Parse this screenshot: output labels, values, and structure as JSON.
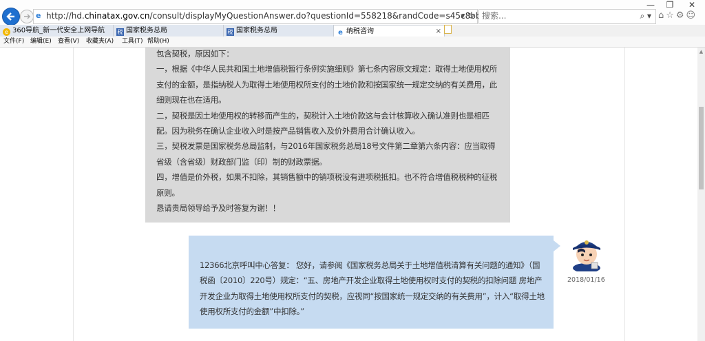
{
  "browser": {
    "url_prefix": "http://hd.",
    "url_domain": "chinatax.gov.cn",
    "url_suffix": "/consult/displayMyQuestionAnswer.do?questionId=558218&randCode=s45c8bbz",
    "url_tools": "▾ ↻",
    "search_placeholder": "搜索...",
    "search_icon": "⌕ ▾",
    "minimize": "—",
    "restore": "❐",
    "close": "✕",
    "right_tools": "⌂☆⚙☺"
  },
  "tabs": [
    {
      "label": "360导航_新一代安全上网导航",
      "icon": "360-icon"
    },
    {
      "label": "国家税务总局",
      "icon": "tax-logo-icon"
    },
    {
      "label": "国家税务总局",
      "icon": "tax-logo-icon"
    },
    {
      "label": "纳税咨询",
      "icon": "ie-icon",
      "active": true,
      "close": "×"
    }
  ],
  "menu": [
    "文件(F)",
    "编辑(E)",
    "查看(V)",
    "收藏夹(A)",
    "工具(T)",
    "帮助(H)"
  ],
  "question": {
    "lines": [
      "包含契税，原因如下：",
      "一，根据《中华人民共和国土地增值税暂行条例实施细则》第七条内容原文规定：取得土地使用权所支付的金额，是指纳税人为取得土地使用权所支付的土地价款和按国家统一规定交纳的有关费用，此细则现在也在适用。",
      "二，契税是因土地使用权的转移而产生的，契税计入土地价款这与会计核算收入确认准则也是相匹配。因为税务在确认企业收入时是按产品销售收入及价外费用合计确认收入。",
      "三，契税发票是国家税务总局监制，与2016年国家税务总局18号文件第二章第六条内容：应当取得省级（含省级）财政部门监（印）制的财政票据。",
      "四，增值是价外税，如果不扣除，其销售额中的销项税没有进项税抵扣。也不符合增值税税种的征税原则。",
      "恳请贵局领导给予及时答复为谢！！"
    ]
  },
  "answer": {
    "text": "12366北京呼叫中心答复： 您好，请参阅《国家税务总局关于土地增值税清算有关问题的通知》（国税函〔2010〕220号）规定：“五、房地产开发企业取得土地使用权时支付的契税的扣除问题 房地产开发企业为取得土地使用权所支付的契税，应视同“按国家统一规定交纳的有关费用”，计入“取得土地使用权所支付的金额”中扣除。”",
    "date": "2018/01/16"
  }
}
